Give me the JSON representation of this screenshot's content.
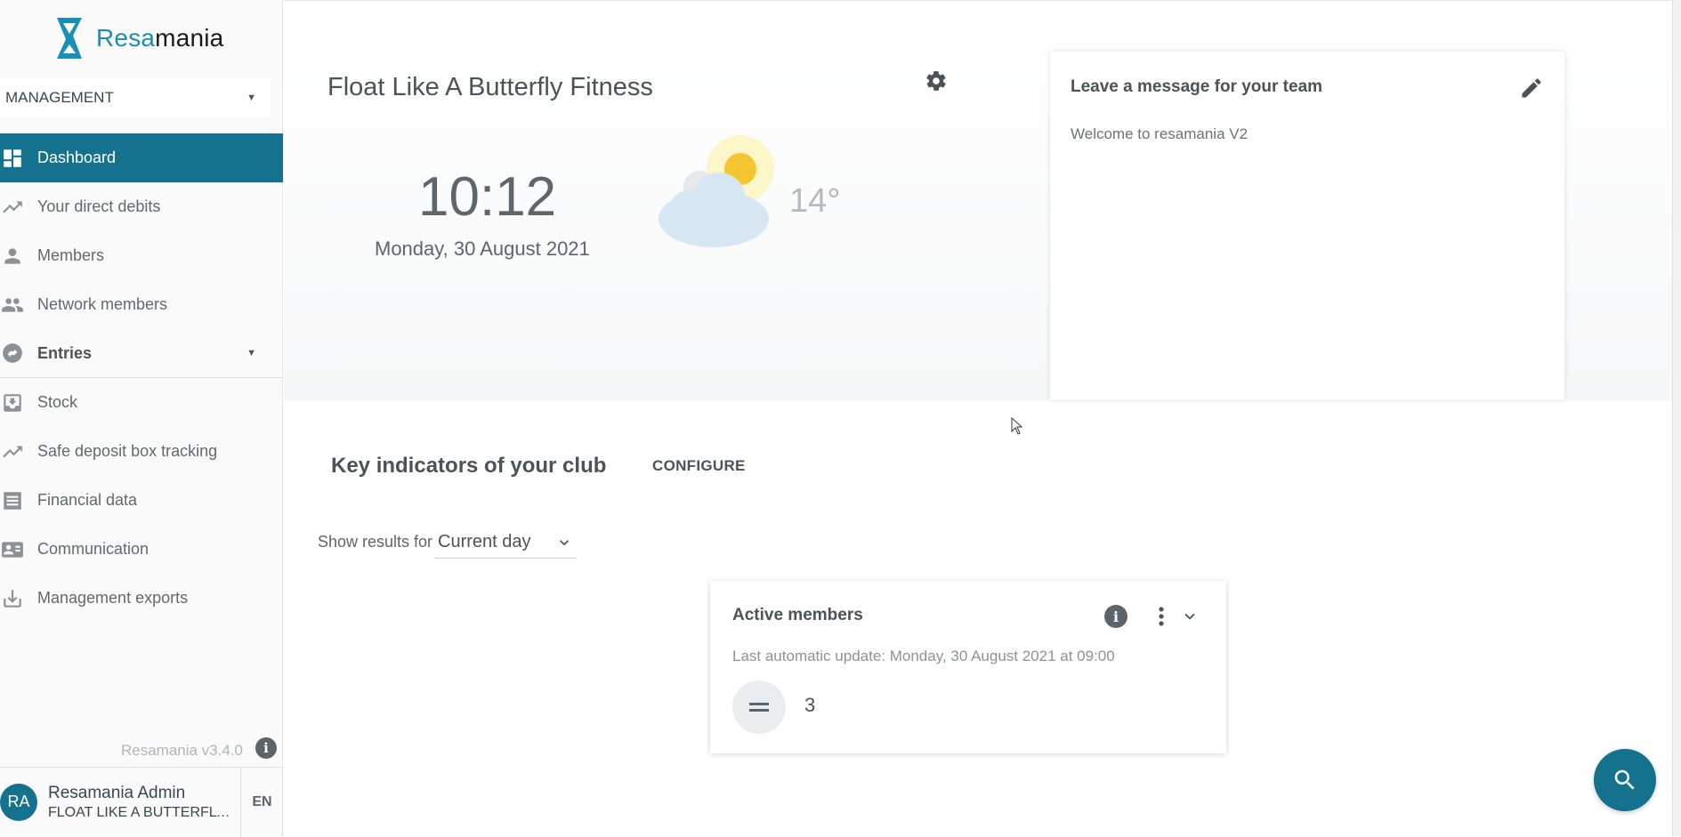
{
  "brand": {
    "name_prefix": "Resa",
    "name_suffix": "mania"
  },
  "sidebar": {
    "mode_select": "MANAGEMENT",
    "items": [
      {
        "label": "Dashboard",
        "icon": "dashboard-icon",
        "active": true
      },
      {
        "label": "Your direct debits",
        "icon": "trending-up-icon"
      },
      {
        "label": "Members",
        "icon": "person-icon"
      },
      {
        "label": "Network members",
        "icon": "people-icon"
      },
      {
        "label": "Entries",
        "icon": "swap-icon",
        "group": true
      },
      {
        "label": "Stock",
        "icon": "stock-icon"
      },
      {
        "label": "Safe deposit box tracking",
        "icon": "trending-up-icon"
      },
      {
        "label": "Financial data",
        "icon": "receipt-icon"
      },
      {
        "label": "Communication",
        "icon": "contact-card-icon"
      },
      {
        "label": "Management exports",
        "icon": "download-icon"
      }
    ],
    "version": "Resamania v3.4.0",
    "user": {
      "initials": "RA",
      "name": "Resamania Admin",
      "club": "FLOAT LIKE A BUTTERFLY FITNESS"
    },
    "language": "EN"
  },
  "header": {
    "club_name": "Float Like A Butterfly Fitness",
    "time": "10:12",
    "date": "Monday, 30 August 2021",
    "temperature": "14°",
    "weather_icon": "partly-cloudy-icon"
  },
  "message_card": {
    "title": "Leave a message for your team",
    "body": "Welcome to resamania V2"
  },
  "indicators": {
    "title": "Key indicators of your club",
    "configure_label": "CONFIGURE",
    "show_results_label": "Show results for",
    "period": "Current day",
    "cards": [
      {
        "title": "Active members",
        "last_update": "Last automatic update: Monday, 30 August 2021 at 09:00",
        "trend_icon": "equal-icon",
        "value": "3"
      }
    ]
  },
  "colors": {
    "primary": "#14728f",
    "accent": "#1a8fb5",
    "sun": "#f5c431"
  }
}
